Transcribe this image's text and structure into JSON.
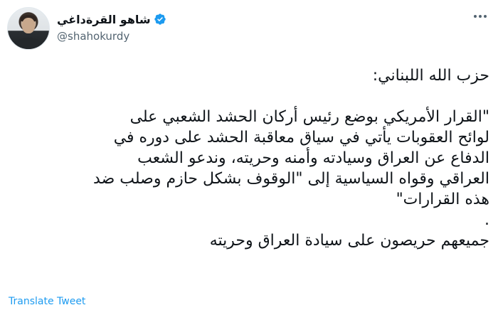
{
  "tweet": {
    "display_name": "شاهو القرةداغي",
    "handle": "@shahokurdy",
    "avatar_icon": "person-avatar",
    "verified_icon": "verified-badge-icon",
    "more_icon": "more-options-icon",
    "verified_color": "#1d9bf0",
    "lines": [
      "حزب الله اللبناني:",
      "",
      "\"القرار الأمريكي بوضع رئيس أركان الحشد الشعبي على",
      "لوائح العقوبات يأتي في سياق معاقبة الحشد على دوره في",
      "الدفاع عن العراق وسيادته وأمنه وحريته، وندعو الشعب",
      "العراقي وقواه السياسية إلى \"الوقوف بشكل حازم وصلب ضد",
      "هذه القرارات\"",
      ".",
      "جميعهم حريصون على سيادة العراق وحريته"
    ],
    "translate_label": "Translate Tweet",
    "link_color": "#1d9bf0"
  }
}
